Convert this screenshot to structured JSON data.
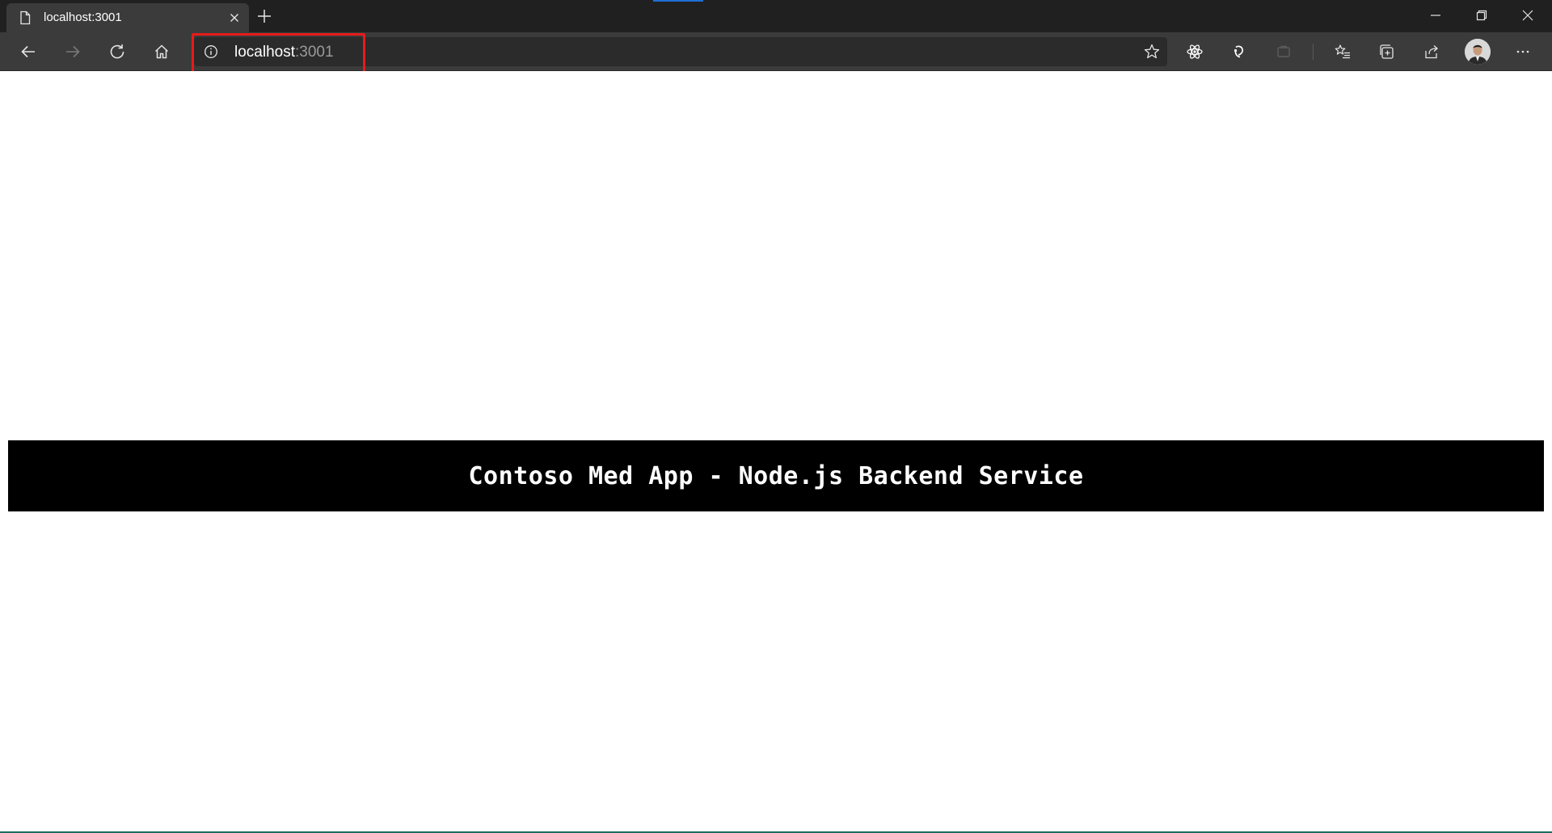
{
  "browser": {
    "tab": {
      "title": "localhost:3001",
      "favicon_icon": "page-icon",
      "close_icon": "close-icon"
    },
    "new_tab_icon": "plus-icon",
    "window_controls": [
      "minimize-icon",
      "restore-icon",
      "close-icon"
    ],
    "toolbar": {
      "buttons": [
        "back-icon",
        "forward-icon",
        "refresh-icon",
        "home-icon"
      ],
      "extensions": [
        "react-devtools-icon",
        "redux-devtools-icon",
        "extension-icon"
      ],
      "actions": [
        "favorites-icon",
        "collections-icon",
        "share-icon",
        "profile-avatar",
        "more-icon"
      ]
    },
    "address": {
      "host": "localhost",
      "port": ":3001",
      "info_icon": "info-icon",
      "favorite_icon": "star-icon"
    },
    "highlight_color": "#e81a1a"
  },
  "page": {
    "banner_title": "Contoso Med App - Node.js Backend Service"
  },
  "colors": {
    "tabstrip": "#202020",
    "toolbar": "#3b3b3b",
    "address_bar": "#2b2b2b",
    "banner": "#000000",
    "banner_text": "#ffffff"
  }
}
